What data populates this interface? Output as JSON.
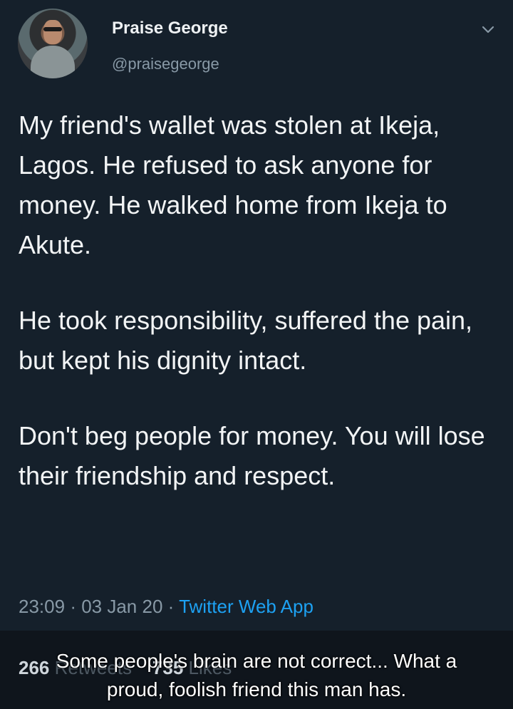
{
  "tweet": {
    "display_name": "Praise George",
    "handle": "@praisegeorge",
    "paragraphs": [
      "My friend's wallet was stolen at Ikeja, Lagos. He refused to ask anyone for money. He walked home from Ikeja to Akute.",
      "He took responsibility, suffered the pain, but kept his dignity intact.",
      "Don't beg people for money. You will lose their friendship and respect."
    ],
    "time": "23:09",
    "date": "03 Jan 20",
    "source": "Twitter Web App",
    "retweets_count": "266",
    "retweets_label": "Retweets",
    "likes_count": "735",
    "likes_label": "Likes"
  },
  "caption": {
    "line1": "Some people's brain are not correct... What a",
    "line2": "proud, foolish friend this man has."
  },
  "icons": {
    "menu": "chevron-down-icon",
    "avatar": "avatar"
  },
  "colors": {
    "background": "#15202b",
    "accent": "#1da1f2",
    "secondary_text": "#8899a6"
  }
}
